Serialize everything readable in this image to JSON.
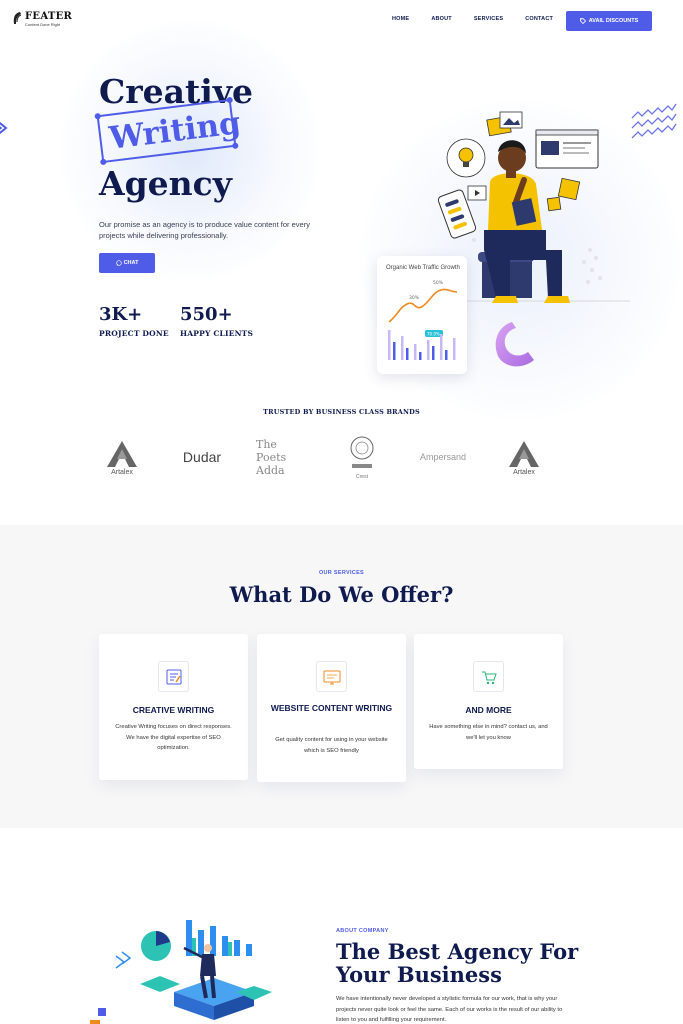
{
  "brand": {
    "name": "FEATER",
    "tagline": "Content Done Right"
  },
  "nav": {
    "links": [
      "HOME",
      "ABOUT",
      "SERVICES",
      "CONTACT"
    ],
    "cta_label": "AVAIL DISCOUNTS",
    "cta_icon": "tag-icon"
  },
  "hero": {
    "title_line1": "Creative",
    "title_highlight": "Writing",
    "title_line3": "Agency",
    "description": "Our promise as an agency is to produce value content for every projects while delivering professionally.",
    "chat_label": "CHAT",
    "chat_icon": "whatsapp-icon",
    "stats": [
      {
        "value": "3K+",
        "label": "PROJECT DONE"
      },
      {
        "value": "550+",
        "label": "HAPPY CLIENTS"
      }
    ],
    "chart_card": {
      "title": "Organic Web Traffic Growth",
      "badges": [
        "30%",
        "50%"
      ],
      "tag": "70.9%"
    }
  },
  "trusted": {
    "heading": "TRUSTED BY BUSINESS CLASS BRANDS",
    "brands": [
      "Artalex",
      "Dudar",
      "The Poets Adda",
      "Crest",
      "Ampersand",
      "Artalex"
    ]
  },
  "services": {
    "label": "OUR SERVICES",
    "heading": "What Do We Offer?",
    "cards": [
      {
        "icon": "writing-icon",
        "title": "CREATIVE WRITING",
        "text": "Creative Writing focuses on direct responses. We have the digital expertise of SEO optimization."
      },
      {
        "icon": "monitor-icon",
        "title": "WEBSITE CONTENT WRITING",
        "text": "Get quality content for using in your website which is SEO friendly"
      },
      {
        "icon": "cart-icon",
        "title": "AND MORE",
        "text": "Have something else in mind? contact us, and we'll let you know"
      }
    ]
  },
  "about": {
    "label": "ABOUT COMPANY",
    "heading": "The Best Agency For Your Business",
    "text": "We have intentionally never developed a stylistic formula for our work, that is why your projects never quite look or feel the same. Each of our works is the result of our ability to listen to you and fulfilling your requirement."
  },
  "colors": {
    "accent": "#4f5ce8",
    "navy": "#0f1a4f",
    "yellow": "#f5c200"
  }
}
